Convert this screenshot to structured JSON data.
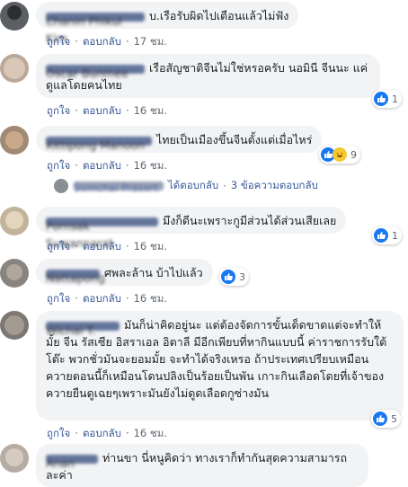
{
  "actions": {
    "like_label": "ถูกใจ",
    "reply_label": "ตอบกลับ",
    "separator": "·"
  },
  "comments": [
    {
      "author": "Chanin Phikul Kim",
      "text": "บ.เรือรับผิดไปเตือนแล้วไม่ฟัง",
      "time": "17 ชม."
    },
    {
      "author": "Oscar Bunmee",
      "text": "เรือสัญชาติจีนไม่ใช่หรอครับ นอมินี จีนนะ แค่ดูแลโดยคนไทย",
      "time": "16 ชม.",
      "reaction_count": "1"
    },
    {
      "author": "Kittipong Manoon",
      "text": "ไทยเป็นเมืองขึ้นจีนตั้งแต่เมื่อไหร่",
      "time": "16 ชม.",
      "reaction_count": "9",
      "reply": {
        "author": "Somchai Prasert",
        "replied_label": "ได้ตอบกลับ",
        "count_label": "3 ข้อความตอบกลับ"
      }
    },
    {
      "author": "Pornsak Suwannarat",
      "text": "มึงก็ดีนะเพราะกูมีส่วนได้ส่วนเสียเลย",
      "time": "16 ชม.",
      "reaction_count": "1"
    },
    {
      "author": "Nattapong",
      "text": "ศพละล้าน บ้าไปแล้ว",
      "time": "16 ชม.",
      "reaction_count": "3"
    },
    {
      "author": "Wichai T.",
      "text": "มันก็น่าคิดอยู่นะ แต่ต้องจัดการขั้นเด็ดขาดแต่จะทำให้มั้ย จีน รัสเซีย อิสราเอล อิตาลี มีอีกเพียบที่หากินแบบนี้ ค่าราชการรับใต้โต๊ะ พวกชั่วมันจะยอมมั้ย จะทำได้จริงเหรอ ถ้าประเทศเปรียบเหมือนควายตอนนี้ก็เหมือนโดนปลิงเป็นร้อยเป็นพัน เกาะกินเลือดโดยที่เจ้าของควายยืนดูเฉยๆเพราะมันยังไม่ดูดเลือดกูซ่างมัน",
      "time": "16 ชม.",
      "reaction_count": "5"
    },
    {
      "author": "Anan",
      "text": "ท่านขา นี่หนูคิดว่า ทางเราก็ทำกันสุดความสามารถละค่า"
    }
  ]
}
